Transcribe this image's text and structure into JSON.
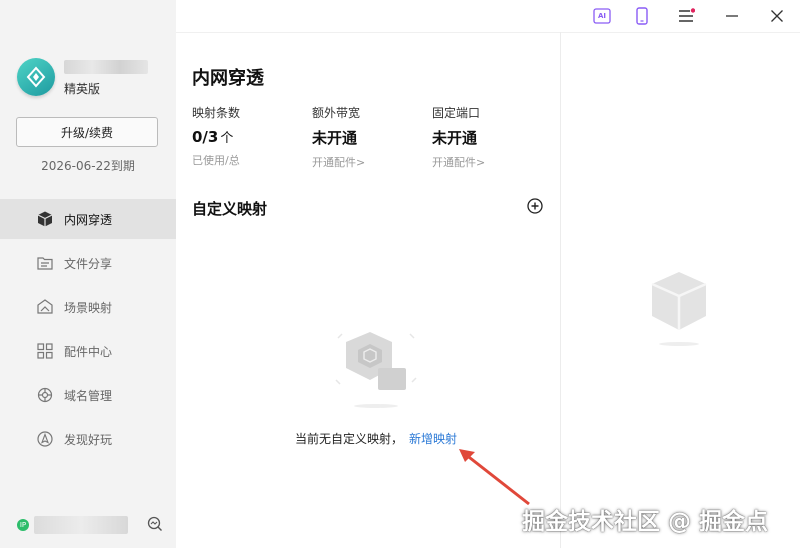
{
  "account": {
    "edition": "精英版",
    "upgrade_label": "升级/续费",
    "expire": "2026-06-22到期"
  },
  "nav": [
    {
      "label": "内网穿透",
      "icon": "cube-icon",
      "active": true
    },
    {
      "label": "文件分享",
      "icon": "folder-share-icon",
      "active": false
    },
    {
      "label": "场景映射",
      "icon": "scene-map-icon",
      "active": false
    },
    {
      "label": "配件中心",
      "icon": "grid-icon",
      "active": false
    },
    {
      "label": "域名管理",
      "icon": "globe-icon",
      "active": false
    },
    {
      "label": "发现好玩",
      "icon": "compass-icon",
      "active": false
    }
  ],
  "footer": {
    "ip_badge": "IP"
  },
  "topbar": {
    "ai_label": "AI"
  },
  "main": {
    "title": "内网穿透",
    "stats": [
      {
        "label": "映射条数",
        "value": "0/3",
        "unit": "个",
        "sub": "已使用/总"
      },
      {
        "label": "额外带宽",
        "value": "未开通",
        "unit": "",
        "sub": "开通配件>"
      },
      {
        "label": "固定端口",
        "value": "未开通",
        "unit": "",
        "sub": "开通配件>"
      }
    ],
    "section_title": "自定义映射",
    "empty_text": "当前无自定义映射，",
    "empty_link": "新增映射"
  },
  "watermark": "掘金技术社区 @ 掘金点",
  "colors": {
    "link": "#2b79d6",
    "arrow": "#e0483a",
    "accent": "#2bb3a8",
    "ip_badge": "#2dbd6b"
  }
}
